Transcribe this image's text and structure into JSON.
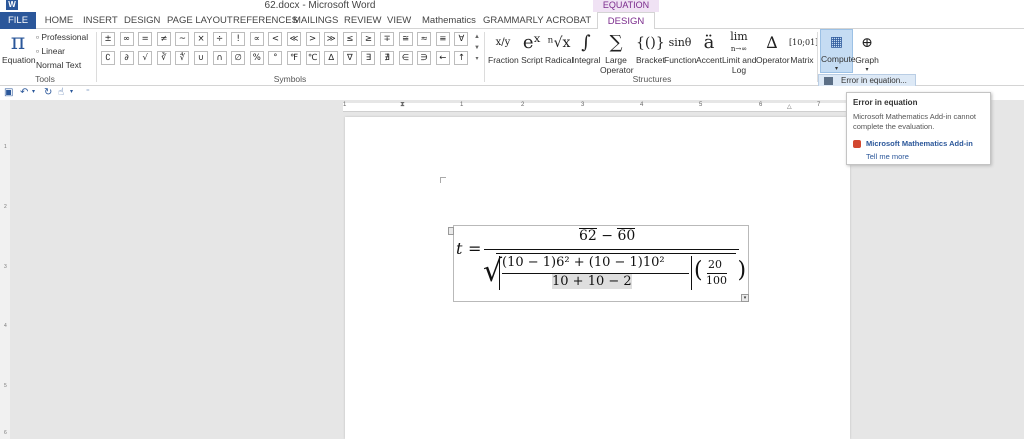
{
  "window": {
    "app_icon": "W",
    "title": "62.docx - Microsoft Word",
    "context_label": "EQUATION TOOLS"
  },
  "tabs": [
    {
      "label": "FILE"
    },
    {
      "label": "HOME"
    },
    {
      "label": "INSERT"
    },
    {
      "label": "DESIGN"
    },
    {
      "label": "PAGE LAYOUT"
    },
    {
      "label": "REFERENCES"
    },
    {
      "label": "MAILINGS"
    },
    {
      "label": "REVIEW"
    },
    {
      "label": "VIEW"
    },
    {
      "label": "Mathematics"
    },
    {
      "label": "GRAMMARLY"
    },
    {
      "label": "ACROBAT"
    },
    {
      "label": "DESIGN"
    }
  ],
  "tools": {
    "equation_icon": "π",
    "equation_label": "Equation",
    "professional": "Professional",
    "linear": "Linear",
    "normal_text": "Normal Text",
    "group_label": "Tools"
  },
  "symbols": {
    "row1": [
      "±",
      "∞",
      "=",
      "≠",
      "~",
      "×",
      "÷",
      "!",
      "∝",
      "<",
      "≪",
      ">",
      "≫",
      "≤",
      "≥",
      "∓",
      "≅",
      "≈",
      "≡",
      "∀"
    ],
    "row2": [
      "∁",
      "∂",
      "√",
      "∛",
      "∜",
      "∪",
      "∩",
      "∅",
      "%",
      "°",
      "℉",
      "℃",
      "∆",
      "∇",
      "∃",
      "∄",
      "∈",
      "∋",
      "←",
      "↑"
    ],
    "group_label": "Symbols"
  },
  "structures": {
    "items": [
      {
        "glyph": "x/y",
        "label": "Fraction"
      },
      {
        "glyph": "eˣ",
        "label": "Script"
      },
      {
        "glyph": "ⁿ√x",
        "label": "Radical"
      },
      {
        "glyph": "∫",
        "label": "Integral"
      },
      {
        "glyph": "∑",
        "label": "Large",
        "label2": "Operator"
      },
      {
        "glyph": "{()}",
        "label": "Bracket"
      },
      {
        "glyph": "sinθ",
        "label": "Function"
      },
      {
        "glyph": "ä",
        "label": "Accent"
      },
      {
        "glyph": "lim",
        "label": "Limit and",
        "label2": "Log"
      },
      {
        "glyph": "∆",
        "label": "Operator"
      },
      {
        "glyph": "[10;01]",
        "label": "Matrix"
      }
    ],
    "limit_sub": "n→∞",
    "group_label": "Structures"
  },
  "compute": {
    "label": "Compute",
    "graph_label": "Graph",
    "menu_item": "Error in equation..."
  },
  "ruler": {
    "numbers": [
      "1",
      "1",
      "2",
      "3",
      "4",
      "5",
      "6",
      "7"
    ]
  },
  "vruler": {
    "numbers": [
      "1",
      "2",
      "3",
      "4",
      "5",
      "6"
    ]
  },
  "equation": {
    "lhs": "t",
    "equals": "=",
    "num_a": "62",
    "minus": "−",
    "num_b": "60",
    "inner_numerator": "(10 − 1)6² + (10 − 1)10²",
    "inner_denominator": "10 + 10 − 2",
    "small_num": "20",
    "small_den": "100"
  },
  "tooltip": {
    "title": "Error in equation",
    "body": "Microsoft Mathematics Add-in cannot complete the evaluation.",
    "link": "Microsoft Mathematics Add-in",
    "more": "Tell me more"
  }
}
